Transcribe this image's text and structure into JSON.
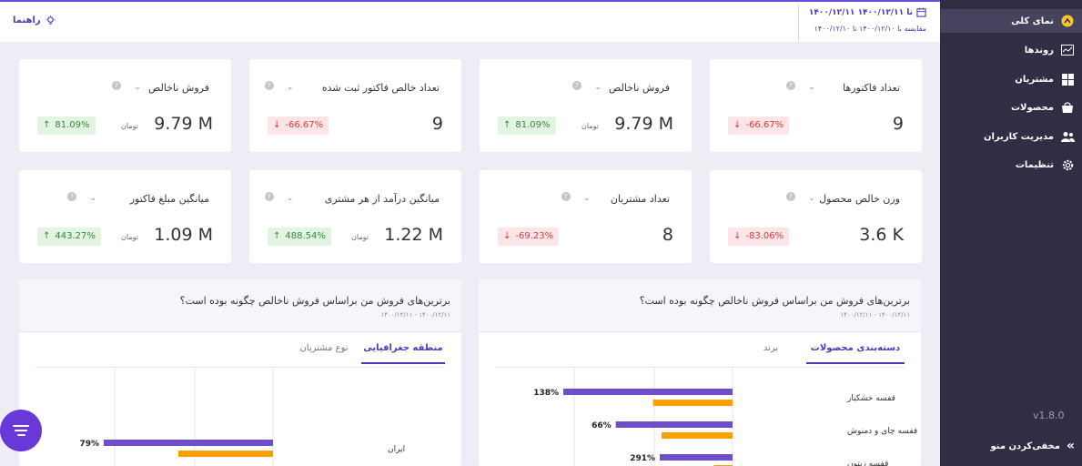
{
  "topbar": {
    "guide_label": "راهنما",
    "date_range": "۱۴۰۰/۱۲/۱۱ تا ۱۴۰۰/۱۲/۱۱",
    "compare_range": "مقایسه با ۱۴۰۰/۱۲/۱۰ تا ۱۴۰۰/۱۲/۱۰"
  },
  "sidebar": {
    "items": [
      {
        "label": "نمای کلی",
        "icon": "dashboard-icon"
      },
      {
        "label": "روندها",
        "icon": "trends-icon"
      },
      {
        "label": "مشتریان",
        "icon": "customers-icon"
      },
      {
        "label": "محصولات",
        "icon": "products-icon"
      },
      {
        "label": "مدیریت کاربران",
        "icon": "user-management-icon"
      },
      {
        "label": "تنظیمات",
        "icon": "gear-icon"
      }
    ],
    "version": "v1.8.0",
    "hide_menu": "مخفی‌کردن منو"
  },
  "kpis": [
    {
      "title": "تعداد فاکتورها",
      "value": "9",
      "unit": "",
      "change": "-66.67%",
      "direction": "down"
    },
    {
      "title": "فروش ناخالص",
      "value": "9.79 M",
      "unit": "تومان",
      "change": "81.09%",
      "direction": "up"
    },
    {
      "title": "تعداد خالص فاکتور ثبت شده",
      "value": "9",
      "unit": "",
      "change": "-66.67%",
      "direction": "down"
    },
    {
      "title": "فروش ناخالص",
      "value": "9.79 M",
      "unit": "تومان",
      "change": "81.09%",
      "direction": "up"
    },
    {
      "title": "وزن خالص محصول",
      "value": "3.6 K",
      "unit": "",
      "change": "-83.06%",
      "direction": "down"
    },
    {
      "title": "تعداد مشتریان",
      "value": "8",
      "unit": "",
      "change": "-69.23%",
      "direction": "down"
    },
    {
      "title": "میانگین درآمد از هر مشتری",
      "value": "1.22 M",
      "unit": "تومان",
      "change": "488.54%",
      "direction": "up"
    },
    {
      "title": "میانگین مبلغ فاکتور",
      "value": "1.09 M",
      "unit": "تومان",
      "change": "443.27%",
      "direction": "up"
    }
  ],
  "panels": [
    {
      "title": "برترین‌های فروش من براساس فروش ناخالص چگونه بوده است؟",
      "subtitle": "۱۴۰۰/۱۲/۱۱ - ۱۴۰۰/۱۲/۱۱",
      "tabs": [
        "دسته‌بندی محصولات",
        "برند"
      ],
      "active_tab": 0
    },
    {
      "title": "برترین‌های فروش من براساس فروش ناخالص چگونه بوده است؟",
      "subtitle": "۱۴۰۰/۱۲/۱۱ - ۱۴۰۰/۱۲/۱۱",
      "tabs": [
        "منطقه جغرافیایی",
        "نوع مشتریان"
      ],
      "active_tab": 0
    }
  ],
  "colors": {
    "accent": "#4a3ab5",
    "current_bar": "#6e4fc9",
    "previous_bar": "#ffa000",
    "sidebar": "#302e45",
    "up": "#2e8b3a",
    "down": "#d63b45"
  },
  "chart_data": [
    {
      "type": "bar",
      "categories": [
        "قفسه خشکبار",
        "قفسه چای و دمنوش",
        "قفسه زیتون"
      ],
      "labels": [
        "138%",
        "66%",
        "291%"
      ],
      "series": [
        {
          "values": [
            1.0,
            0.69,
            0.43
          ]
        },
        {
          "values": [
            0.47,
            0.42,
            0.11
          ]
        }
      ]
    },
    {
      "type": "bar",
      "categories": [
        "ایران"
      ],
      "labels": [
        "79%"
      ],
      "series": [
        {
          "values": [
            1.0
          ]
        },
        {
          "values": [
            0.56
          ]
        }
      ]
    }
  ]
}
